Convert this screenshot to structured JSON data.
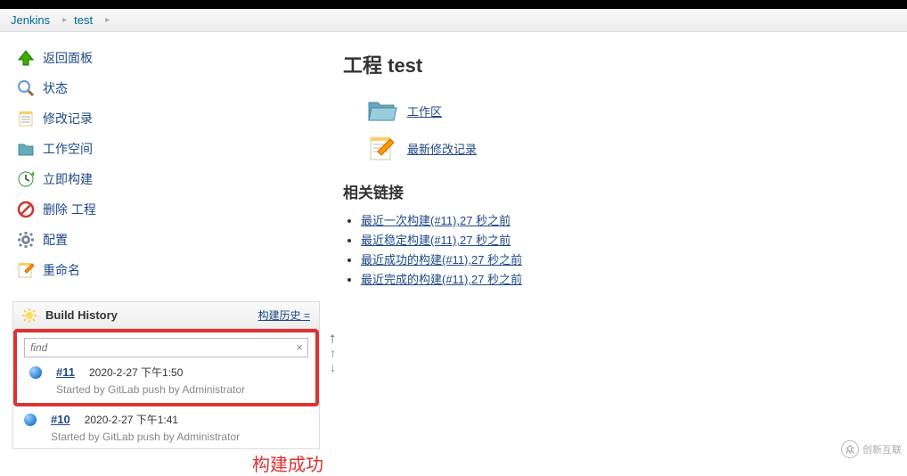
{
  "breadcrumb": {
    "jenkins": "Jenkins",
    "project": "test"
  },
  "sidebar": {
    "back": "返回面板",
    "status": "状态",
    "changes": "修改记录",
    "workspace": "工作空间",
    "build_now": "立即构建",
    "delete": "删除 工程",
    "configure": "配置",
    "rename": "重命名"
  },
  "build_history": {
    "title": "Build History",
    "trend": "构建历史 =",
    "find_placeholder": "find",
    "builds": [
      {
        "ball": "blue",
        "number": "#11",
        "timestamp": "2020-2-27 下午1:50",
        "started_by": "Started by GitLab push by Administrator"
      },
      {
        "ball": "blue",
        "number": "#10",
        "timestamp": "2020-2-27 下午1:41",
        "started_by": "Started by GitLab push by Administrator"
      }
    ]
  },
  "annotation": "构建成功",
  "main": {
    "heading": "工程 test",
    "workspace_link": "工作区",
    "changes_link": "最新修改记录",
    "related_heading": "相关链接",
    "links": [
      "最近一次构建(#11),27 秒之前",
      "最近稳定构建(#11),27 秒之前",
      "最近成功的构建(#11),27 秒之前",
      "最近完成的构建(#11),27 秒之前"
    ]
  },
  "watermark": "创新互联"
}
